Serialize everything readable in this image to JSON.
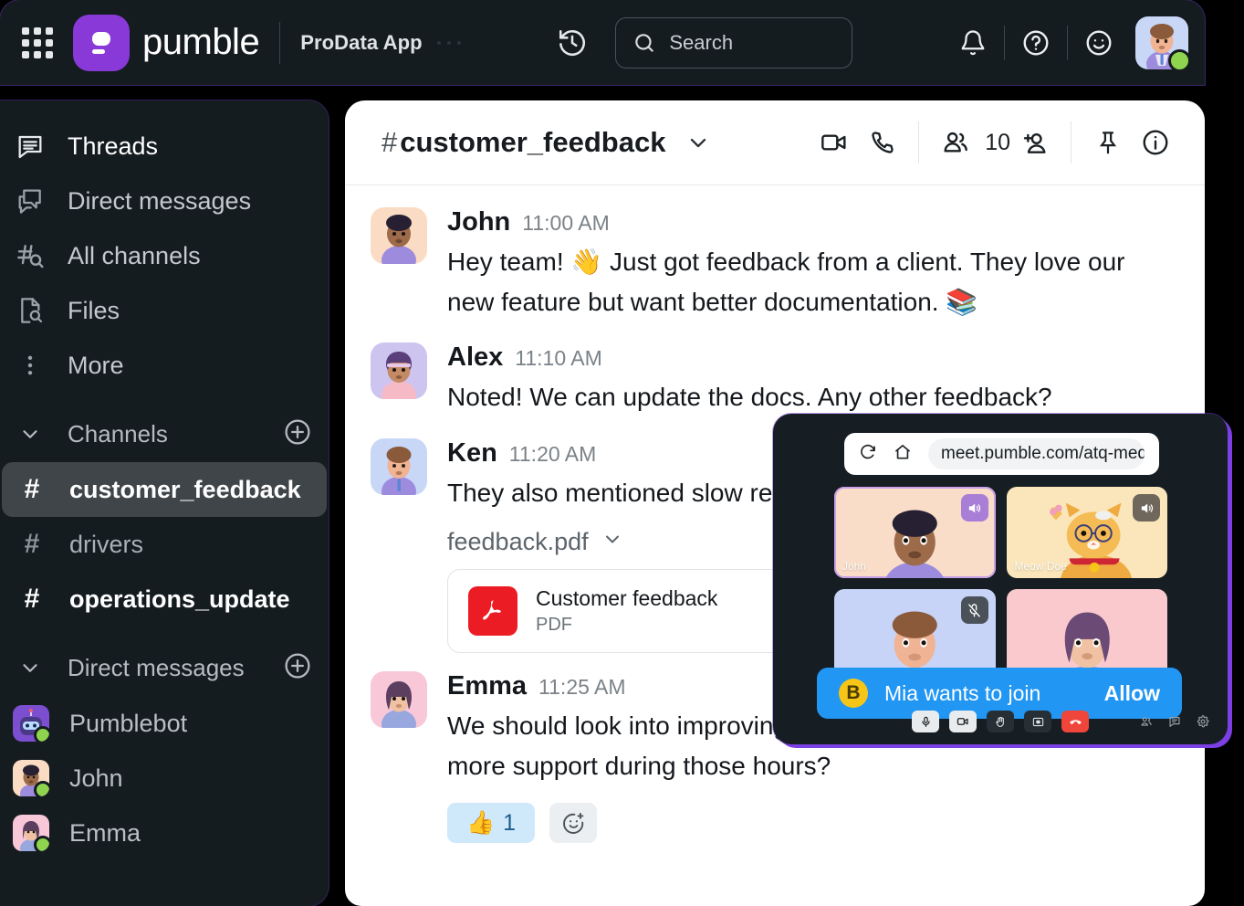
{
  "header": {
    "brand_name": "pumble",
    "workspace": "ProData App",
    "apps_grid_icon": "apps-grid-icon",
    "history_icon": "history-icon",
    "search": {
      "placeholder": "Search",
      "icon": "search-icon"
    },
    "notifications_icon": "bell-icon",
    "help_icon": "question-circle-icon",
    "status_icon": "smiley-icon",
    "avatar": "user-avatar"
  },
  "sidebar": {
    "nav": [
      {
        "label": "Threads",
        "icon": "threads-icon"
      },
      {
        "label": "Direct messages",
        "icon": "direct-messages-icon"
      },
      {
        "label": "All channels",
        "icon": "all-channels-icon"
      },
      {
        "label": "Files",
        "icon": "files-icon"
      },
      {
        "label": "More",
        "icon": "more-dots-icon"
      }
    ],
    "channels_section": {
      "label": "Channels",
      "add_icon": "plus-circle-icon",
      "chevron": "chevron-down-icon"
    },
    "channels": [
      {
        "name": "customer_feedback",
        "state": "selected"
      },
      {
        "name": "drivers",
        "state": "read"
      },
      {
        "name": "operations_update",
        "state": "unread"
      }
    ],
    "dm_section": {
      "label": "Direct messages",
      "add_icon": "plus-circle-icon",
      "chevron": "chevron-down-icon"
    },
    "dms": [
      {
        "name": "Pumblebot",
        "presence": "online"
      },
      {
        "name": "John",
        "presence": "online"
      },
      {
        "name": "Emma",
        "presence": "online"
      }
    ]
  },
  "channel_header": {
    "hash": "#",
    "name": "customer_feedback",
    "chevron_icon": "chevron-down-icon",
    "video_icon": "video-camera-icon",
    "call_icon": "phone-icon",
    "members_icon": "members-icon",
    "member_count": "10",
    "add_member_icon": "add-person-icon",
    "pin_icon": "pin-icon",
    "info_icon": "info-circle-icon"
  },
  "messages": [
    {
      "author": "John",
      "time": "11:00 AM",
      "text": "Hey team! 👋 Just got feedback from a client. They love our new feature but want better documentation. 📚"
    },
    {
      "author": "Alex",
      "time": "11:10 AM",
      "text": "Noted! We can update the docs. Any other feedback?"
    },
    {
      "author": "Ken",
      "time": "11:20 AM",
      "text": "They also mentioned slow response times.",
      "attachment_name": "feedback.pdf",
      "attachment_chevron": "chevron-down-icon",
      "attachment_title": "Customer feedback",
      "attachment_type": "PDF"
    },
    {
      "author": "Emma",
      "time": "11:25 AM",
      "text": "We should look into improving our response times. Maybe add more support during those hours?",
      "reaction_emoji": "👍",
      "reaction_count": "1",
      "add_reaction_icon": "add-reaction-icon"
    }
  ],
  "call_window": {
    "reload_icon": "reload-icon",
    "home_icon": "home-icon",
    "url": "meet.pumble.com/atq-medd-sir",
    "tiles": [
      {
        "name": "John",
        "badge": "speaker-on-icon",
        "bg": "#f9ddc9",
        "badge_bg": "#a87ed6",
        "border": "#c9a0e8"
      },
      {
        "name": "Meow Doe",
        "badge": "speaker-on-icon",
        "bg": "#fbe6bb",
        "badge_bg": "#6f675c",
        "border": "transparent"
      },
      {
        "name": "",
        "badge": "microphone-muted-icon",
        "bg": "#c8d4f7",
        "badge_bg": "#4a5159",
        "border": "transparent"
      },
      {
        "name": "",
        "badge": "",
        "bg": "#f9c9cd",
        "badge_bg": "",
        "border": "transparent"
      }
    ],
    "toast": {
      "initial": "B",
      "text": "Mia wants to join",
      "action": "Allow"
    },
    "controls": [
      {
        "name": "microphone-icon",
        "style": "light"
      },
      {
        "name": "camera-icon",
        "style": "light"
      },
      {
        "name": "raise-hand-icon",
        "style": "dark"
      },
      {
        "name": "share-screen-icon",
        "style": "dark"
      },
      {
        "name": "end-call-icon",
        "style": "red"
      }
    ],
    "controls_right": [
      {
        "name": "participants-icon"
      },
      {
        "name": "chat-icon"
      },
      {
        "name": "settings-gear-icon"
      }
    ]
  },
  "colors": {
    "brand_purple": "#8839d8",
    "sidebar_bg": "#151c20",
    "call_glow": "#7b3fe4",
    "toast_blue": "#2196f3",
    "online_green": "#8fd44e",
    "pdf_red": "#ec1c24"
  }
}
